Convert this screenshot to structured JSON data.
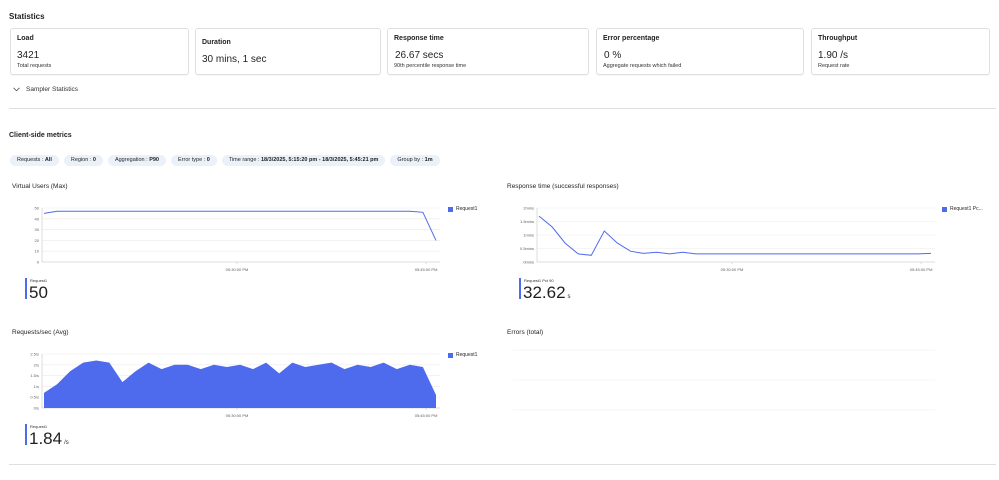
{
  "statistics": {
    "title": "Statistics",
    "cards": [
      {
        "label": "Load",
        "value": "3421",
        "sub": "Total requests"
      },
      {
        "label": "Duration",
        "value": "30 mins, 1 sec",
        "sub": ""
      },
      {
        "label": "Response time",
        "value": "26.67 secs",
        "sub": "90th percentile response time"
      },
      {
        "label": "Error percentage",
        "value": "0 %",
        "sub": "Aggregate requests which failed"
      },
      {
        "label": "Throughput",
        "value": "1.90 /s",
        "sub": "Request rate"
      }
    ],
    "sampler_label": "Sampler Statistics"
  },
  "client_metrics": {
    "title": "Client-side metrics",
    "filters": [
      {
        "key": "Requests :",
        "value": "All"
      },
      {
        "key": "Region :",
        "value": "0"
      },
      {
        "key": "Aggregation :",
        "value": "P90"
      },
      {
        "key": "Error type :",
        "value": "0"
      },
      {
        "key": "Time range :",
        "value": "18/3/2025, 5:15:20 pm - 18/3/2025, 5:45:21 pm"
      },
      {
        "key": "Group by :",
        "value": "1m"
      }
    ]
  },
  "charts": {
    "vu": {
      "title": "Virtual Users (Max)",
      "legend": "Request1",
      "metric_label": "Request1",
      "metric_value": "50",
      "metric_unit": ""
    },
    "rt": {
      "title": "Response time (successful responses)",
      "legend": "Request1 Pc...",
      "metric_label": "Request1 Pct 90",
      "metric_value": "32.62",
      "metric_unit": "s"
    },
    "rps": {
      "title": "Requests/sec (Avg)",
      "legend": "Request1",
      "metric_label": "Request1",
      "metric_value": "1.84",
      "metric_unit": "/s"
    },
    "errors": {
      "title": "Errors (total)"
    }
  },
  "chart_data": [
    {
      "type": "line",
      "title": "Virtual Users (Max)",
      "x_ticks": [
        "05:30:00 PM",
        "05:45:00 PM"
      ],
      "y_ticks": [
        "50",
        "40",
        "30",
        "20",
        "10",
        "0"
      ],
      "ylim": [
        0,
        50
      ],
      "series": [
        {
          "name": "Request1",
          "values": [
            45,
            47,
            47,
            47,
            47,
            47,
            47,
            47,
            47,
            47,
            47,
            47,
            47,
            47,
            47,
            47,
            47,
            47,
            47,
            47,
            47,
            47,
            47,
            47,
            47,
            47,
            47,
            47,
            47,
            46,
            20
          ]
        }
      ],
      "color": "#4f6bed"
    },
    {
      "type": "line",
      "title": "Response time (successful responses)",
      "x_ticks": [
        "05:30:00 PM",
        "05:45:00 PM"
      ],
      "y_ticks": [
        "2mins",
        "1.5mins",
        "1mins",
        "0.5mins",
        "0mins"
      ],
      "ylim": [
        0,
        2
      ],
      "series": [
        {
          "name": "Request1 Pc...",
          "values": [
            1.7,
            1.3,
            0.7,
            0.3,
            0.25,
            1.15,
            0.7,
            0.4,
            0.32,
            0.36,
            0.3,
            0.36,
            0.3,
            0.3,
            0.3,
            0.3,
            0.3,
            0.3,
            0.3,
            0.3,
            0.3,
            0.3,
            0.3,
            0.3,
            0.3,
            0.3,
            0.3,
            0.3,
            0.3,
            0.3,
            0.32
          ]
        }
      ],
      "color": "#4f6bed"
    },
    {
      "type": "area",
      "title": "Requests/sec (Avg)",
      "x_ticks": [
        "05:30:00 PM",
        "05:45:00 PM"
      ],
      "y_ticks": [
        "2.5/s",
        "2/s",
        "1.5/s",
        "1/s",
        "0.5/s",
        "0/s"
      ],
      "ylim": [
        0,
        2.5
      ],
      "series": [
        {
          "name": "Request1",
          "values": [
            0.7,
            1.1,
            1.7,
            2.1,
            2.2,
            2.1,
            1.2,
            1.7,
            2.1,
            1.8,
            2.0,
            2.0,
            1.8,
            2.0,
            1.9,
            2.0,
            1.8,
            2.1,
            1.6,
            2.1,
            1.9,
            2.0,
            2.1,
            1.8,
            2.0,
            1.9,
            2.1,
            1.8,
            2.0,
            1.9,
            0.6
          ]
        }
      ],
      "color": "#4f6bed"
    },
    {
      "type": "line",
      "title": "Errors (total)",
      "series": []
    }
  ],
  "colors": {
    "accent": "#4f6bed",
    "pill_bg": "#eaf1f8",
    "border": "#e1dfdd"
  },
  "icons": {
    "expander": "chevron-down-icon"
  }
}
